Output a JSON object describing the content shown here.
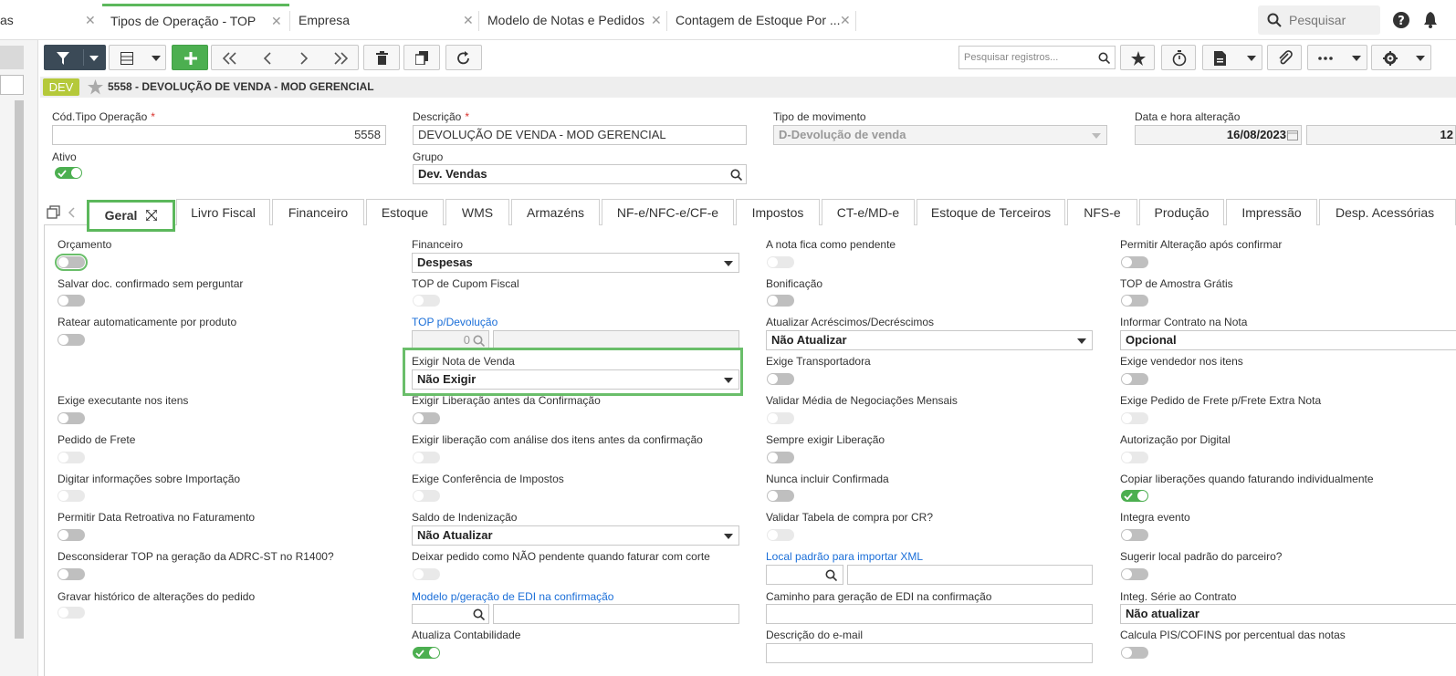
{
  "top_tabs": [
    {
      "label": "as"
    },
    {
      "label": "Tipos de Operação - TOP"
    },
    {
      "label": "Empresa"
    },
    {
      "label": "Modelo de Notas e Pedidos"
    },
    {
      "label": "Contagem de Estoque Por ..."
    }
  ],
  "top_search": {
    "placeholder": "Pesquisar"
  },
  "toolbar": {
    "search_placeholder": "Pesquisar registros..."
  },
  "record": {
    "badge": "DEV",
    "title": "5558 - DEVOLUÇÃO DE VENDA - MOD GERENCIAL"
  },
  "header_fields": {
    "cod_label": "Cód.Tipo Operação",
    "cod_value": "5558",
    "desc_label": "Descrição",
    "desc_value": "DEVOLUÇÃO DE VENDA - MOD GERENCIAL",
    "tipo_mov_label": "Tipo de movimento",
    "tipo_mov_value": "D-Devolução de venda",
    "data_label": "Data e hora alteração",
    "data_value": "16/08/2023",
    "hora_value": "12",
    "ativo_label": "Ativo",
    "ativo_on": true,
    "grupo_label": "Grupo",
    "grupo_value": "Dev. Vendas"
  },
  "form_tabs": [
    "Geral",
    "Livro Fiscal",
    "Financeiro",
    "Estoque",
    "WMS",
    "Armazéns",
    "NF-e/NFC-e/CF-e",
    "Impostos",
    "CT-e/MD-e",
    "Estoque de Terceiros",
    "NFS-e",
    "Produção",
    "Impressão",
    "Desp. Acessórias"
  ],
  "geral": {
    "col1": [
      {
        "label": "Orçamento",
        "toggle": "off"
      },
      {
        "label": "Salvar doc. confirmado sem perguntar",
        "toggle": "off"
      },
      {
        "label": "Ratear automaticamente por produto",
        "toggle": "off"
      },
      {
        "label": "Exige executante nos itens",
        "toggle": "off"
      },
      {
        "label": "Pedido de Frete",
        "toggle": "disabled"
      },
      {
        "label": "Digitar informações sobre Importação",
        "toggle": "disabled"
      },
      {
        "label": "Permitir Data Retroativa no Faturamento",
        "toggle": "off"
      },
      {
        "label": "Desconsiderar TOP na geração da ADRC-ST no R1400?",
        "toggle": "off"
      },
      {
        "label": "Gravar histórico de alterações do pedido",
        "toggle": "disabled"
      }
    ],
    "col2": {
      "financeiro_label": "Financeiro",
      "financeiro_value": "Despesas",
      "cupom_label": "TOP de Cupom Fiscal",
      "top_dev_label": "TOP p/Devolução",
      "top_dev_value": "0",
      "exigir_nota_label": "Exigir Nota de Venda",
      "exigir_nota_value": "Não Exigir",
      "exigir_lib_label": "Exigir Liberação antes da Confirmação",
      "exigir_lib_analise_label": "Exigir liberação com análise dos itens antes da confirmação",
      "exige_conf_label": "Exige Conferência de Impostos",
      "saldo_label": "Saldo de Indenização",
      "saldo_value": "Não Atualizar",
      "deixar_label": "Deixar pedido como NÃO pendente quando faturar com corte",
      "modelo_edi_label": "Modelo p/geração de EDI na confirmação",
      "atualiza_cont_label": "Atualiza Contabilidade"
    },
    "col3": {
      "pendente_label": "A nota fica como pendente",
      "bonificacao_label": "Bonificação",
      "acresc_label": "Atualizar Acréscimos/Decréscimos",
      "acresc_value": "Não Atualizar",
      "transportadora_label": "Exige Transportadora",
      "validar_media_label": "Validar Média de Negociações Mensais",
      "sempre_lib_label": "Sempre exigir Liberação",
      "nunca_label": "Nunca incluir Confirmada",
      "validar_tabela_label": "Validar Tabela de compra por CR?",
      "local_xml_label": "Local padrão para importar XML",
      "caminho_edi_label": "Caminho para geração de EDI na confirmação",
      "desc_email_label": "Descrição do e-mail"
    },
    "col4": {
      "permitir_alt_label": "Permitir Alteração após confirmar",
      "amostra_label": "TOP de Amostra Grátis",
      "contrato_label": "Informar Contrato na Nota",
      "contrato_value": "Opcional",
      "vendedor_label": "Exige vendedor nos itens",
      "pedido_frete_label": "Exige Pedido de Frete p/Frete Extra Nota",
      "autorizacao_label": "Autorização por Digital",
      "copiar_label": "Copiar liberações quando faturando individualmente",
      "integra_label": "Integra evento",
      "sugerir_label": "Sugerir local padrão do parceiro?",
      "integ_serie_label": "Integ. Série ao Contrato",
      "integ_serie_value": "Não atualizar",
      "calcula_pis_label": "Calcula PIS/COFINS por percentual das notas"
    }
  }
}
